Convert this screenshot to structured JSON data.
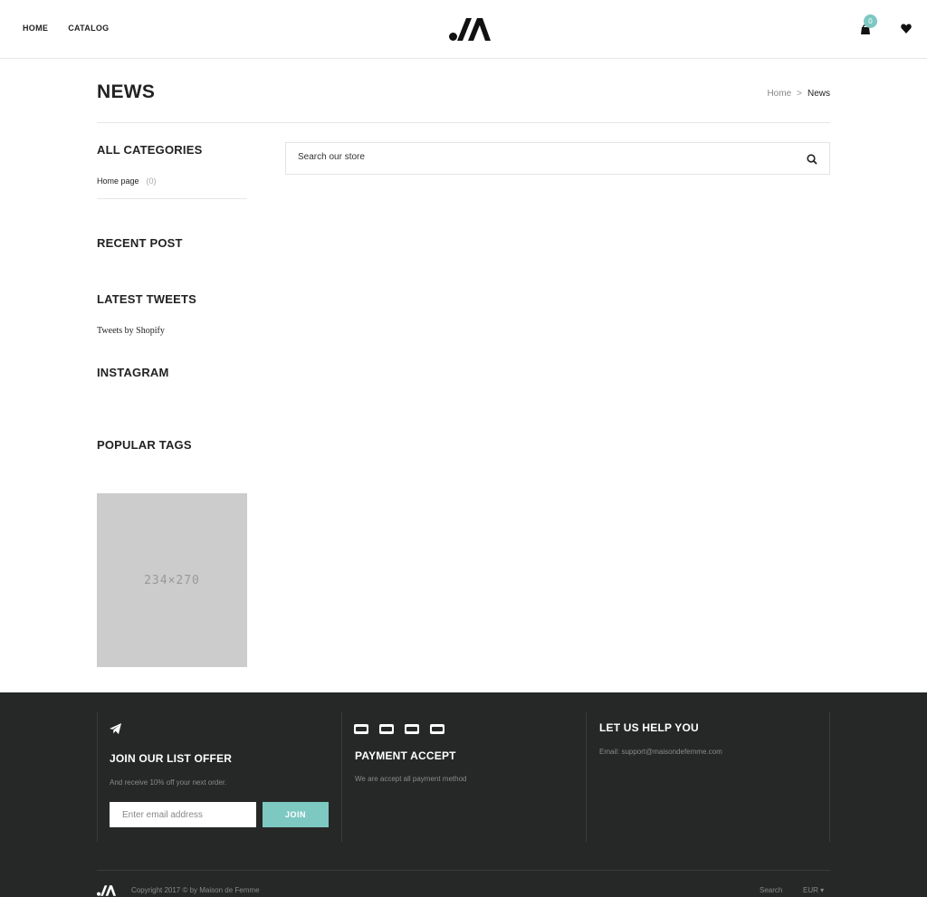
{
  "header": {
    "nav": [
      {
        "label": "HOME"
      },
      {
        "label": "CATALOG"
      }
    ],
    "cart_count": "0",
    "icons": {
      "cart": "cart-icon",
      "wishlist": "heart-icon",
      "logo": "brand-logo"
    }
  },
  "page": {
    "title": "NEWS",
    "breadcrumb": {
      "home": "Home",
      "separator": ">",
      "current": "News"
    }
  },
  "sidebar": {
    "categories_heading": "ALL CATEGORIES",
    "categories": [
      {
        "label": "Home page",
        "count": "(0)"
      }
    ],
    "recent_post_heading": "RECENT POST",
    "latest_tweets_heading": "LATEST TWEETS",
    "tweets_link": "Tweets by Shopify",
    "instagram_heading": "INSTAGRAM",
    "popular_tags_heading": "POPULAR TAGS",
    "banner_placeholder": "234×270"
  },
  "search": {
    "placeholder": "Search our store",
    "icon": "search-icon"
  },
  "footer": {
    "newsletter": {
      "icon": "paper-plane-icon",
      "heading": "JOIN OUR LIST OFFER",
      "text": "And receive 10% off your next order.",
      "email_placeholder": "Enter email address",
      "join_label": "JOIN"
    },
    "payment": {
      "icons": [
        "visa-icon",
        "mastercard-icon",
        "paypal-icon",
        "discover-icon"
      ],
      "heading": "PAYMENT ACCEPT",
      "text": "We are accept all payment method"
    },
    "help": {
      "heading": "LET US HELP YOU",
      "email": "Email: support@maisondefemme.com"
    },
    "copyright": "Copyright 2017 © by Maison de Femme",
    "search_label": "Search",
    "currency": "EUR ▾"
  },
  "colors": {
    "accent": "#7ec8c2",
    "footer_bg": "#262727",
    "placeholder_bg": "#cccccc"
  }
}
